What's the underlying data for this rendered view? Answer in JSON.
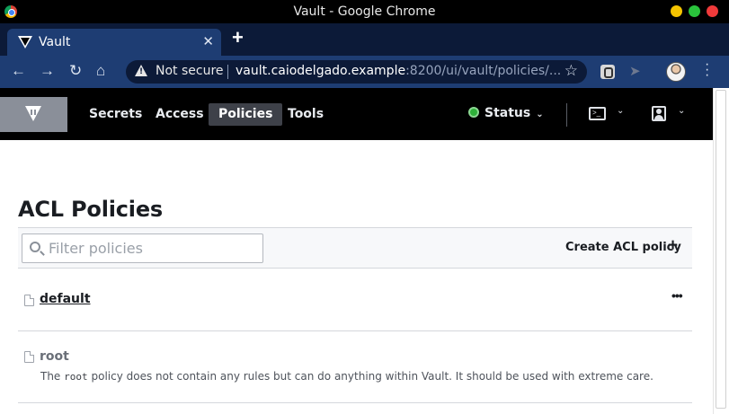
{
  "window": {
    "title": "Vault - Google Chrome"
  },
  "browser": {
    "tab_title": "Vault",
    "tab_close": "✕",
    "new_tab": "+",
    "not_secure": "Not secure",
    "url_host": "vault.caiodelgado.example",
    "url_rest": ":8200/ui/vault/policies/...",
    "icons": [
      "back-icon",
      "forward-icon",
      "reload-icon",
      "home-icon",
      "warning-icon",
      "star-icon",
      "extension-icon",
      "profile-avatar",
      "menu-icon"
    ]
  },
  "header": {
    "nav": [
      {
        "label": "Secrets"
      },
      {
        "label": "Access"
      },
      {
        "label": "Policies",
        "active": true
      },
      {
        "label": "Tools"
      }
    ],
    "status_label": "Status",
    "status_color": "#2eb039",
    "console_glyph": ">_"
  },
  "main": {
    "title": "ACL Policies",
    "filter_placeholder": "Filter policies",
    "create_label": "Create ACL policy",
    "create_icon": "+",
    "policies": [
      {
        "name": "default",
        "menu": "•••"
      },
      {
        "name": "root",
        "desc_prefix": "The",
        "desc_code": "root",
        "desc_suffix": "policy does not contain any rules but can do anything within Vault. It should be used with extreme care."
      }
    ]
  },
  "colors": {
    "header_bg": "#000000",
    "browser_tab": "#1e3d73",
    "active_nav": "#3e4149"
  }
}
